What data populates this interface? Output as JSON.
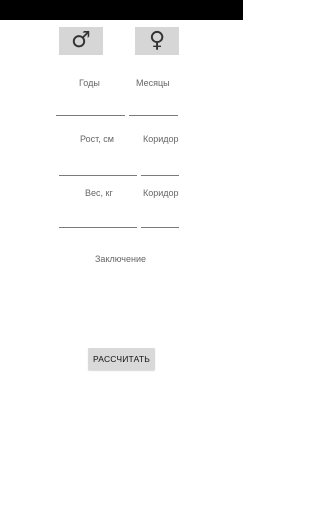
{
  "gender": {
    "male_symbol": "♂",
    "female_symbol": "♀"
  },
  "form": {
    "years_label": "Годы",
    "months_label": "Месяцы",
    "height_label": "Рост, см",
    "height_corridor_label": "Коридор",
    "weight_label": "Вес, кг",
    "weight_corridor_label": "Коридор",
    "years_value": "",
    "months_value": "",
    "height_value": "",
    "height_corridor_value": "",
    "weight_value": "",
    "weight_corridor_value": ""
  },
  "result": {
    "conclusion_label": "Заключение"
  },
  "actions": {
    "calculate_label": "РАССЧИТАТЬ"
  }
}
